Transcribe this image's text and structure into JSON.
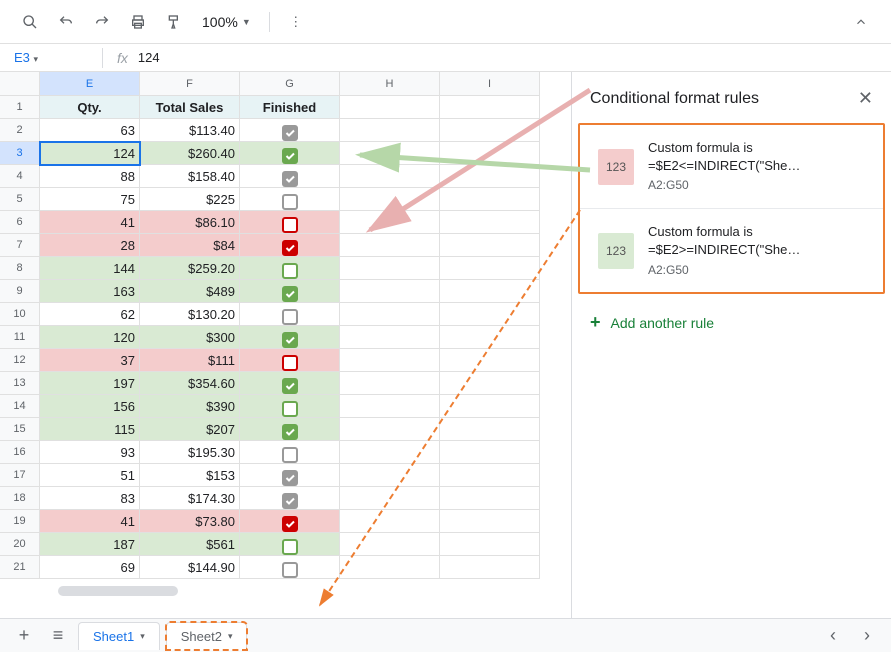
{
  "toolbar": {
    "zoom": "100%"
  },
  "namebox": {
    "ref": "E3",
    "formula": "124"
  },
  "columns": [
    "E",
    "F",
    "G",
    "H",
    "I"
  ],
  "headers": [
    "Qty.",
    "Total Sales",
    "Finished"
  ],
  "active_cell": {
    "row": 3,
    "col": "E"
  },
  "rows": [
    {
      "n": 2,
      "qty": 63,
      "sales": "$113.40",
      "fin": "on-grey",
      "hl": ""
    },
    {
      "n": 3,
      "qty": 124,
      "sales": "$260.40",
      "fin": "on-green",
      "hl": "green"
    },
    {
      "n": 4,
      "qty": 88,
      "sales": "$158.40",
      "fin": "on-grey",
      "hl": ""
    },
    {
      "n": 5,
      "qty": 75,
      "sales": "$225",
      "fin": "off",
      "hl": ""
    },
    {
      "n": 6,
      "qty": 41,
      "sales": "$86.10",
      "fin": "off-red",
      "hl": "red"
    },
    {
      "n": 7,
      "qty": 28,
      "sales": "$84",
      "fin": "on-red",
      "hl": "red"
    },
    {
      "n": 8,
      "qty": 144,
      "sales": "$259.20",
      "fin": "off-green",
      "hl": "green"
    },
    {
      "n": 9,
      "qty": 163,
      "sales": "$489",
      "fin": "on-green",
      "hl": "green"
    },
    {
      "n": 10,
      "qty": 62,
      "sales": "$130.20",
      "fin": "off",
      "hl": ""
    },
    {
      "n": 11,
      "qty": 120,
      "sales": "$300",
      "fin": "on-green",
      "hl": "green"
    },
    {
      "n": 12,
      "qty": 37,
      "sales": "$111",
      "fin": "off-red",
      "hl": "red"
    },
    {
      "n": 13,
      "qty": 197,
      "sales": "$354.60",
      "fin": "on-green",
      "hl": "green"
    },
    {
      "n": 14,
      "qty": 156,
      "sales": "$390",
      "fin": "off-green",
      "hl": "green"
    },
    {
      "n": 15,
      "qty": 115,
      "sales": "$207",
      "fin": "on-green",
      "hl": "green"
    },
    {
      "n": 16,
      "qty": 93,
      "sales": "$195.30",
      "fin": "off",
      "hl": ""
    },
    {
      "n": 17,
      "qty": 51,
      "sales": "$153",
      "fin": "on-grey",
      "hl": ""
    },
    {
      "n": 18,
      "qty": 83,
      "sales": "$174.30",
      "fin": "on-grey",
      "hl": ""
    },
    {
      "n": 19,
      "qty": 41,
      "sales": "$73.80",
      "fin": "on-red",
      "hl": "red"
    },
    {
      "n": 20,
      "qty": 187,
      "sales": "$561",
      "fin": "off-green",
      "hl": "green"
    },
    {
      "n": 21,
      "qty": 69,
      "sales": "$144.90",
      "fin": "off",
      "hl": ""
    }
  ],
  "sidepanel": {
    "title": "Conditional format rules",
    "rules": [
      {
        "swatch": "sw-red",
        "sample": "123",
        "title": "Custom formula is",
        "formula": "=$E2<=INDIRECT(\"She…",
        "range": "A2:G50"
      },
      {
        "swatch": "sw-green",
        "sample": "123",
        "title": "Custom formula is",
        "formula": "=$E2>=INDIRECT(\"She…",
        "range": "A2:G50"
      }
    ],
    "add_label": "Add another rule"
  },
  "tabs": {
    "sheet1": "Sheet1",
    "sheet2": "Sheet2"
  }
}
